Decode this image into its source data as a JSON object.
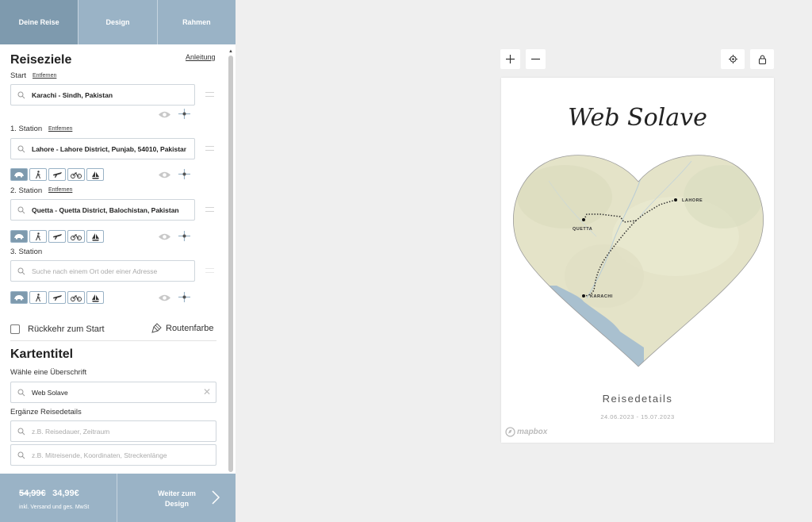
{
  "tabs": [
    {
      "label": "Deine Reise",
      "active": true
    },
    {
      "label": "Design",
      "active": false
    },
    {
      "label": "Rahmen",
      "active": false
    }
  ],
  "destinations": {
    "title": "Reiseziele",
    "guide_link": "Anleitung",
    "remove_label": "Entfernen",
    "start": {
      "label": "Start",
      "value": "Karachi - Sindh, Pakistan"
    },
    "stations": [
      {
        "label": "1. Station",
        "value": "Lahore - Lahore District, Punjab, 54010, Pakistan",
        "removable": true
      },
      {
        "label": "2. Station",
        "value": "Quetta - Quetta District, Balochistan, Pakistan",
        "removable": true
      },
      {
        "label": "3. Station",
        "value": "",
        "placeholder": "Suche nach einem Ort oder einer Adresse",
        "removable": false
      }
    ],
    "transport_modes": [
      "car-icon",
      "walk-icon",
      "plane-icon",
      "bike-icon",
      "boat-icon"
    ],
    "return_label": "Rückkehr zum Start",
    "route_color_label": "Routenfarbe"
  },
  "map_title": {
    "title": "Kartentitel",
    "heading_label": "Wähle eine Überschrift",
    "heading_value": "Web Solave",
    "details_label": "Ergänze Reisedetails",
    "details_placeholder_1": "z.B. Reisedauer, Zeitraum",
    "details_placeholder_2": "z.B. Mitreisende, Koordinaten, Streckenlänge"
  },
  "bottom": {
    "old_price": "54,99€",
    "new_price": "34,99€",
    "price_note": "inkl. Versand und ges. MwSt",
    "next_label_1": "Weiter zum",
    "next_label_2": "Design"
  },
  "poster": {
    "title": "Web Solave",
    "details": "Reisedetails",
    "dates": "24.06.2023 - 15.07.2023",
    "cities": {
      "quetta": "QUETTA",
      "lahore": "LAHORE",
      "karachi": "KARACHI"
    },
    "mapbox": "mapbox"
  },
  "colors": {
    "accent": "#9ab3c6",
    "accent_dark": "#7e9aae",
    "map_land": "#e4e3c8",
    "map_water": "#a9c0cf"
  }
}
